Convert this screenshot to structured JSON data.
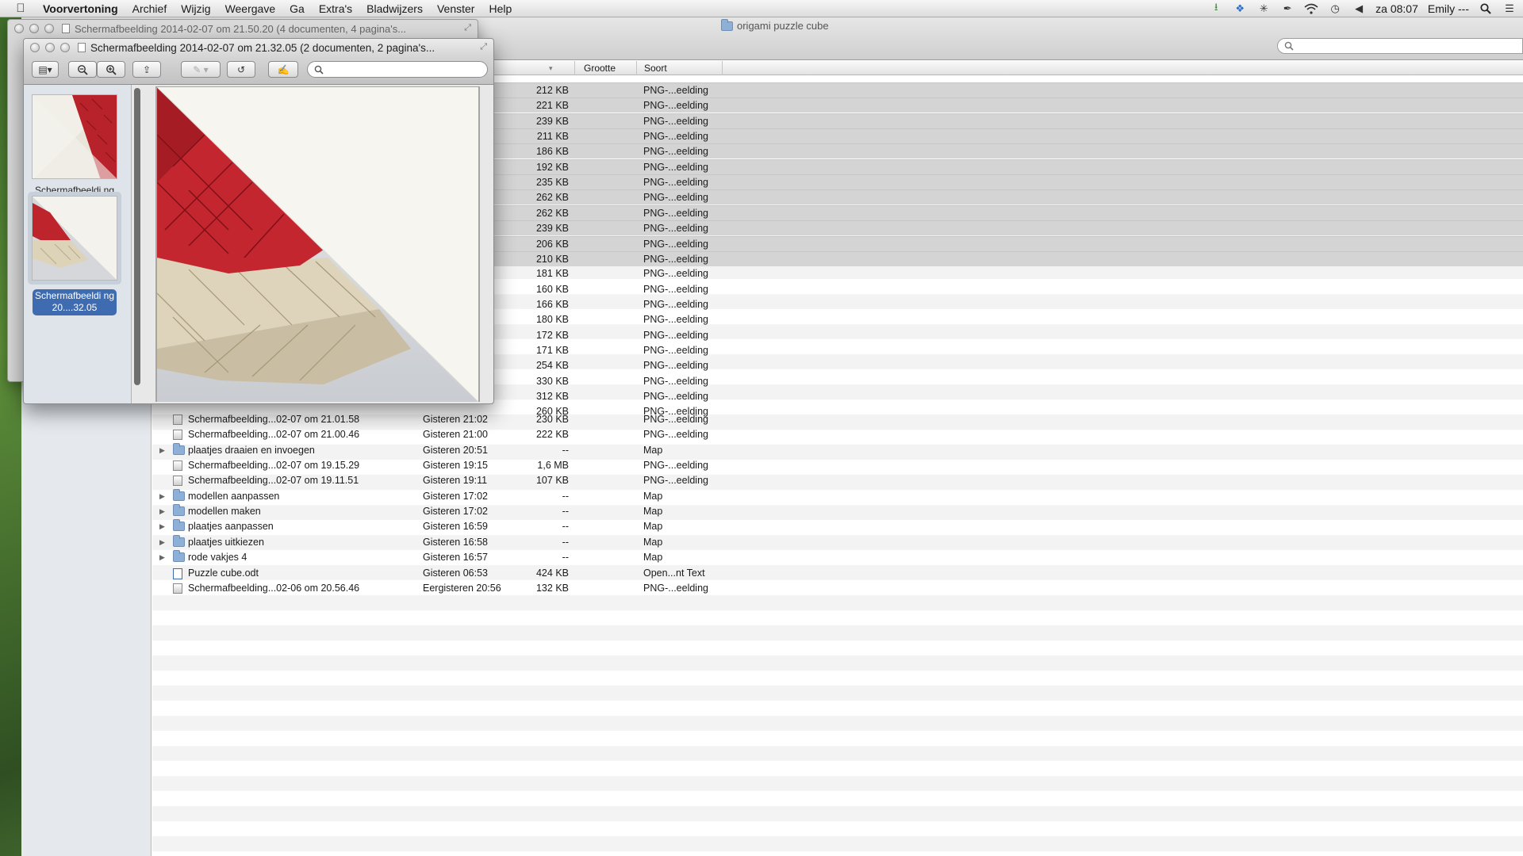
{
  "menubar": {
    "app": "Voorvertoning",
    "items": [
      "Archief",
      "Wijzig",
      "Weergave",
      "Ga",
      "Extra's",
      "Bladwijzers",
      "Venster",
      "Help"
    ],
    "clock": "za 08:07",
    "user": "Emily ---"
  },
  "finder": {
    "title": "origami puzzle cube",
    "columns": {
      "size": "Grootte",
      "kind": "Soort"
    },
    "top_rows": [
      {
        "size": "212 KB",
        "kind": "PNG-...eelding",
        "selected": true
      },
      {
        "size": "221 KB",
        "kind": "PNG-...eelding",
        "selected": true
      },
      {
        "size": "239 KB",
        "kind": "PNG-...eelding",
        "selected": true
      },
      {
        "size": "211 KB",
        "kind": "PNG-...eelding",
        "selected": true
      },
      {
        "size": "186 KB",
        "kind": "PNG-...eelding",
        "selected": true
      },
      {
        "size": "192 KB",
        "kind": "PNG-...eelding",
        "selected": true
      },
      {
        "size": "235 KB",
        "kind": "PNG-...eelding",
        "selected": true
      },
      {
        "size": "262 KB",
        "kind": "PNG-...eelding",
        "selected": true
      },
      {
        "size": "262 KB",
        "kind": "PNG-...eelding",
        "selected": true
      },
      {
        "size": "239 KB",
        "kind": "PNG-...eelding",
        "selected": true
      },
      {
        "size": "206 KB",
        "kind": "PNG-...eelding",
        "selected": true
      },
      {
        "size": "210 KB",
        "kind": "PNG-...eelding",
        "selected": true
      },
      {
        "size": "181 KB",
        "kind": "PNG-...eelding",
        "selected": false
      },
      {
        "size": "160 KB",
        "kind": "PNG-...eelding",
        "selected": false
      },
      {
        "size": "166 KB",
        "kind": "PNG-...eelding",
        "selected": false
      },
      {
        "size": "180 KB",
        "kind": "PNG-...eelding",
        "selected": false
      },
      {
        "size": "172 KB",
        "kind": "PNG-...eelding",
        "selected": false
      },
      {
        "size": "171 KB",
        "kind": "PNG-...eelding",
        "selected": false
      },
      {
        "size": "254 KB",
        "kind": "PNG-...eelding",
        "selected": false
      },
      {
        "size": "330 KB",
        "kind": "PNG-...eelding",
        "selected": false
      },
      {
        "size": "312 KB",
        "kind": "PNG-...eelding",
        "selected": false
      },
      {
        "size": "260 KB",
        "kind": "PNG-...eelding",
        "selected": false
      }
    ],
    "rows": [
      {
        "name": "Schermafbeelding...02-07 om 21.01.58",
        "date": "Gisteren 21:02",
        "size": "230 KB",
        "kind": "PNG-...eelding",
        "icon": "png",
        "folder": false
      },
      {
        "name": "Schermafbeelding...02-07 om 21.00.46",
        "date": "Gisteren 21:00",
        "size": "222 KB",
        "kind": "PNG-...eelding",
        "icon": "png",
        "folder": false
      },
      {
        "name": "plaatjes draaien en invoegen",
        "date": "Gisteren 20:51",
        "size": "--",
        "kind": "Map",
        "icon": "folder",
        "folder": true
      },
      {
        "name": "Schermafbeelding...02-07 om 19.15.29",
        "date": "Gisteren 19:15",
        "size": "1,6 MB",
        "kind": "PNG-...eelding",
        "icon": "png",
        "folder": false
      },
      {
        "name": "Schermafbeelding...02-07 om 19.11.51",
        "date": "Gisteren 19:11",
        "size": "107 KB",
        "kind": "PNG-...eelding",
        "icon": "png",
        "folder": false
      },
      {
        "name": "modellen aanpassen",
        "date": "Gisteren 17:02",
        "size": "--",
        "kind": "Map",
        "icon": "folder",
        "folder": true
      },
      {
        "name": "modellen maken",
        "date": "Gisteren 17:02",
        "size": "--",
        "kind": "Map",
        "icon": "folder",
        "folder": true
      },
      {
        "name": "plaatjes aanpassen",
        "date": "Gisteren 16:59",
        "size": "--",
        "kind": "Map",
        "icon": "folder",
        "folder": true
      },
      {
        "name": "plaatjes uitkiezen",
        "date": "Gisteren 16:58",
        "size": "--",
        "kind": "Map",
        "icon": "folder",
        "folder": true
      },
      {
        "name": "rode vakjes 4",
        "date": "Gisteren 16:57",
        "size": "--",
        "kind": "Map",
        "icon": "folder",
        "folder": true
      },
      {
        "name": "Puzzle cube.odt",
        "date": "Gisteren 06:53",
        "size": "424 KB",
        "kind": "Open...nt Text",
        "icon": "doc",
        "folder": false
      },
      {
        "name": "Schermafbeelding...02-06 om 20.56.46",
        "date": "Eergisteren 20:56",
        "size": "132 KB",
        "kind": "PNG-...eelding",
        "icon": "png",
        "folder": false
      }
    ]
  },
  "preview_back": {
    "title": "Schermafbeelding 2014-02-07 om 21.50.20 (4 documenten, 4 pagina's..."
  },
  "preview_front": {
    "title": "Schermafbeelding 2014-02-07 om 21.32.05 (2 documenten, 2 pagina's...",
    "search_placeholder": "",
    "thumbnails": [
      {
        "label": "Schermafbeeldi ng",
        "selected": false
      },
      {
        "label": "Schermafbeeldi ng 20....32.05",
        "selected": true
      }
    ]
  },
  "colors": {
    "selection_row": "#d4d4d4",
    "sidebar_selection": "#3f6cb0",
    "origami_red": "#c0262e",
    "origami_cream": "#ddd3b9"
  }
}
